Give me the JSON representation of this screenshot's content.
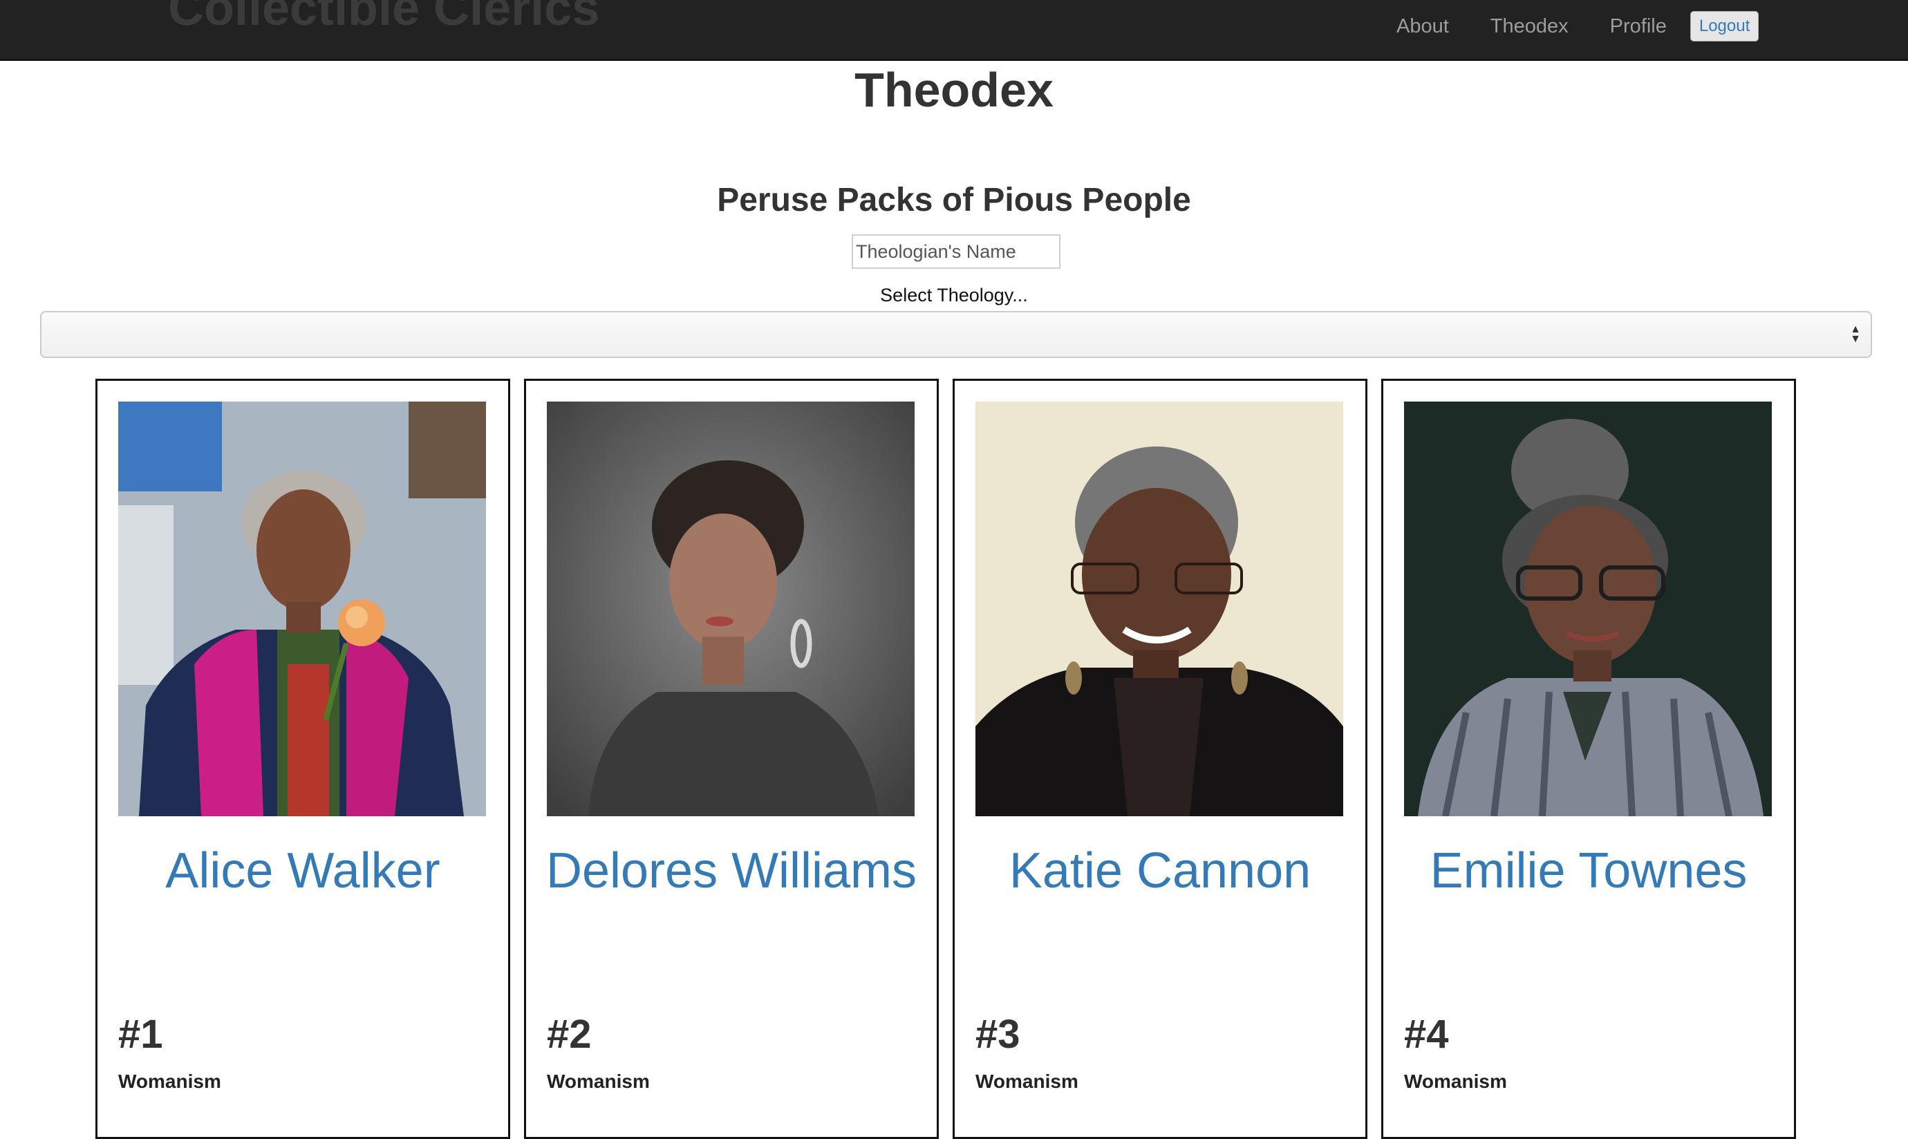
{
  "navbar": {
    "brand": "Collectible Clerics",
    "links": [
      "About",
      "Theodex",
      "Profile"
    ],
    "logout_label": "Logout"
  },
  "page": {
    "title": "Theodex",
    "subtitle": "Peruse Packs of Pious People"
  },
  "filters": {
    "name_placeholder": "Theologian's Name",
    "name_value": "",
    "theology_label": "Select Theology...",
    "theology_selected": ""
  },
  "cards": [
    {
      "name": "Alice Walker",
      "number": "#1",
      "theology": "Womanism"
    },
    {
      "name": "Delores Williams",
      "number": "#2",
      "theology": "Womanism"
    },
    {
      "name": "Katie Cannon",
      "number": "#3",
      "theology": "Womanism"
    },
    {
      "name": "Emilie Townes",
      "number": "#4",
      "theology": "Womanism"
    }
  ],
  "colors": {
    "navbar_bg": "#222222",
    "link_blue": "#337ab7",
    "nav_text": "#9d9d9d"
  }
}
